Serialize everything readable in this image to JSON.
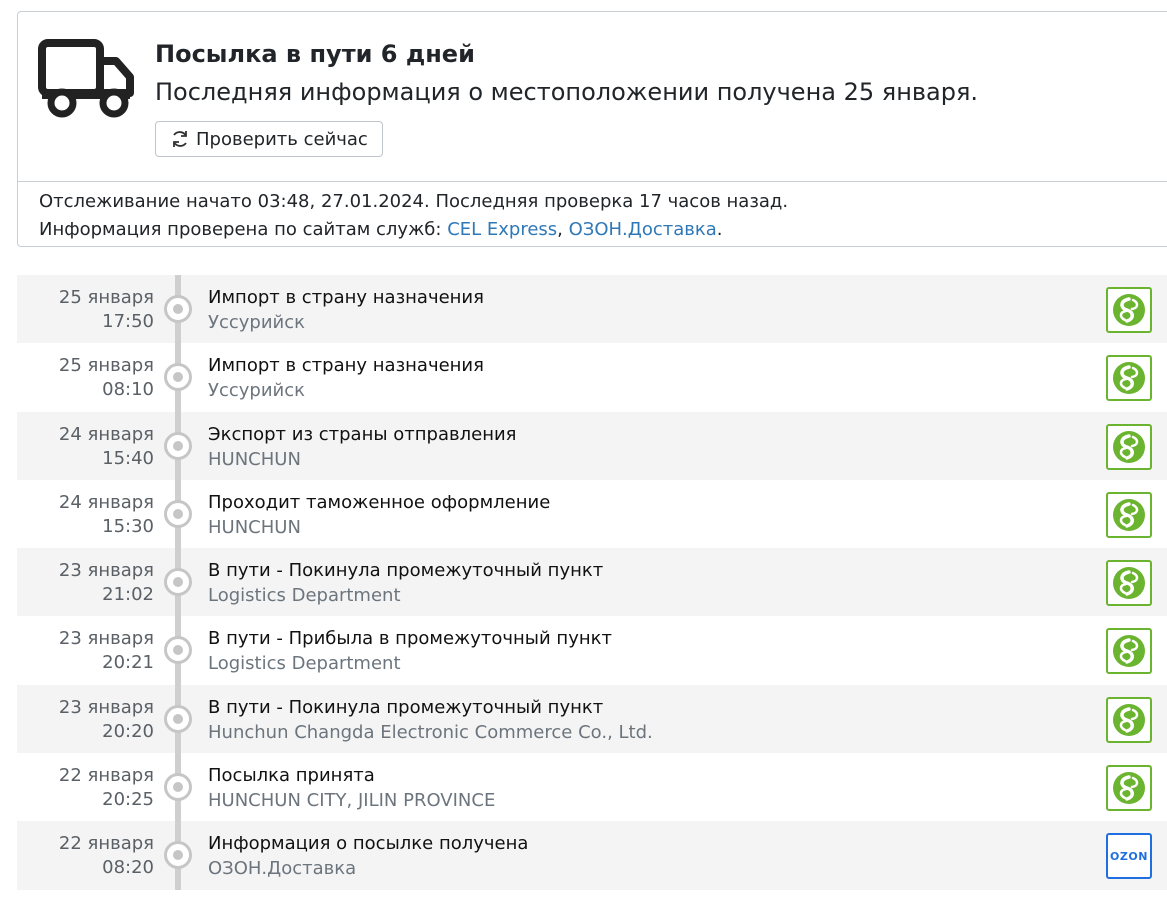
{
  "status": {
    "title": "Посылка в пути 6 дней",
    "subtitle": "Последняя информация о местоположении получена 25 января.",
    "check_button_label": "Проверить сейчас",
    "tracking_info": "Отслеживание начато 03:48, 27.01.2024. Последняя проверка 17 часов назад.",
    "checked_prefix": "Информация проверена по сайтам служб: ",
    "services": [
      "CEL Express",
      "ОЗОН.Доставка"
    ],
    "separator": ", ",
    "suffix": "."
  },
  "icons": {
    "truck": "truck-icon",
    "refresh": "refresh-icon",
    "cel_logo": "cel-express-logo",
    "ozon_logo": "ozon-logo"
  },
  "colors": {
    "link": "#2f78b7",
    "cel_green": "#6ab42f",
    "ozon_blue": "#1f6fe0",
    "rail": "#cfcfcf"
  },
  "events": [
    {
      "date": "25 января",
      "time": "17:50",
      "title": "Импорт в страну назначения",
      "place": "Уссурийск",
      "carrier": "cel"
    },
    {
      "date": "25 января",
      "time": "08:10",
      "title": "Импорт в страну назначения",
      "place": "Уссурийск",
      "carrier": "cel"
    },
    {
      "date": "24 января",
      "time": "15:40",
      "title": "Экспорт из страны отправления",
      "place": "HUNCHUN",
      "carrier": "cel"
    },
    {
      "date": "24 января",
      "time": "15:30",
      "title": "Проходит таможенное оформление",
      "place": "HUNCHUN",
      "carrier": "cel"
    },
    {
      "date": "23 января",
      "time": "21:02",
      "title": "В пути - Покинула промежуточный пункт",
      "place": "Logistics Department",
      "carrier": "cel"
    },
    {
      "date": "23 января",
      "time": "20:21",
      "title": "В пути - Прибыла в промежуточный пункт",
      "place": "Logistics Department",
      "carrier": "cel"
    },
    {
      "date": "23 января",
      "time": "20:20",
      "title": "В пути - Покинула промежуточный пункт",
      "place": "Hunchun Changda Electronic Commerce Co., Ltd.",
      "carrier": "cel"
    },
    {
      "date": "22 января",
      "time": "20:25",
      "title": "Посылка принята",
      "place": "HUNCHUN CITY, JILIN PROVINCE",
      "carrier": "cel"
    },
    {
      "date": "22 января",
      "time": "08:20",
      "title": "Информация о посылке получена",
      "place": "ОЗОН.Доставка",
      "carrier": "ozon"
    }
  ],
  "ozon_logo_text": "OZON"
}
